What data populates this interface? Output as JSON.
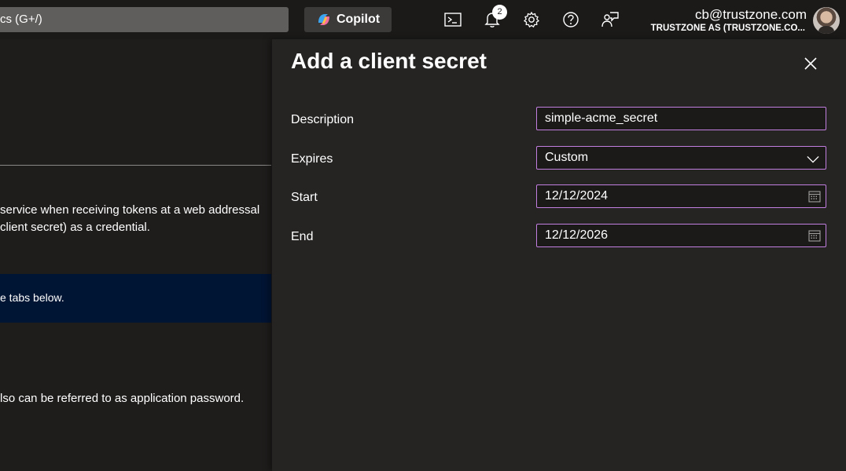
{
  "topbar": {
    "search_text": "cs (G+/)",
    "copilot_label": "Copilot",
    "notification_count": "2",
    "user_email": "cb@trustzone.com",
    "user_tenant": "TRUSTZONE AS (TRUSTZONE.CO..."
  },
  "left_pane": {
    "line1": "service when receiving tokens at a web addressal",
    "line2": "client secret) as a credential.",
    "info_text": "e tabs below.",
    "line3": "lso can be referred to as application password."
  },
  "panel": {
    "title": "Add a client secret",
    "fields": {
      "description": {
        "label": "Description",
        "value": "simple-acme_secret"
      },
      "expires": {
        "label": "Expires",
        "value": "Custom"
      },
      "start": {
        "label": "Start",
        "value": "12/12/2024"
      },
      "end": {
        "label": "End",
        "value": "12/12/2026"
      }
    }
  },
  "icons": [
    "copilot-icon",
    "terminal-icon",
    "bell-icon",
    "gear-icon",
    "help-icon",
    "feedback-icon",
    "close-icon",
    "chevron-down-icon",
    "calendar-icon"
  ],
  "colors": {
    "field_border": "#c27fe0",
    "info_bar": "#001433",
    "panel_bg": "#252423"
  }
}
